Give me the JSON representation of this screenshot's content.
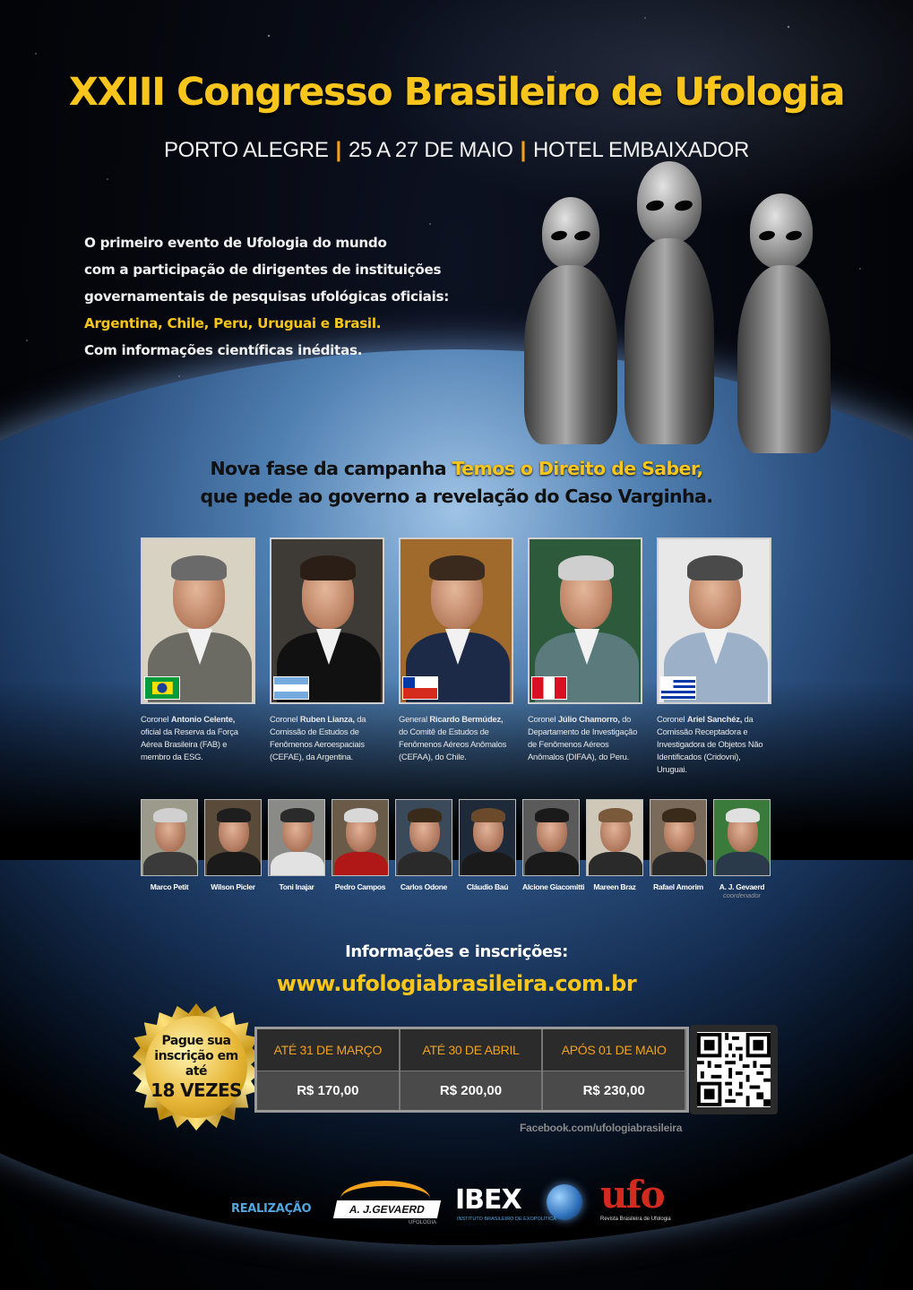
{
  "header": {
    "title": "XXIII Congresso Brasileiro de Ufologia",
    "location": "PORTO ALEGRE",
    "dates": "25 A 27 DE MAIO",
    "venue": "HOTEL EMBAIXADOR",
    "separator": "|"
  },
  "intro": {
    "line1": "O primeiro evento de Ufologia do mundo",
    "line2": "com a participação de dirigentes de instituições",
    "line3": "governamentais de pesquisas ufológicas oficiais:",
    "countries": "Argentina, Chile, Peru, Uruguai e Brasil.",
    "line5": "Com informações científicas inéditas."
  },
  "campaign": {
    "prefix": "Nova fase da campanha ",
    "name": "Temos o Direito de Saber,",
    "line2": "que pede ao governo a revelação do Caso Varginha."
  },
  "main_speakers": [
    {
      "rank": "Coronel ",
      "name": "Antonio Celente,",
      "desc": " oficial da Reserva da Força Aérea Brasileira (FAB) e membro da ESG.",
      "flag": "brazil",
      "bg": "#d8d2c2",
      "suit": "#6b6a63",
      "hair": "#6a6a6a"
    },
    {
      "rank": "Coronel ",
      "name": "Ruben Lianza,",
      "desc": " da Comissão de Estudos de Fenômenos Aeroespaciais (CEFAE), da Argentina.",
      "flag": "argentina",
      "bg": "#3e3a36",
      "suit": "#111111",
      "hair": "#2a1e16"
    },
    {
      "rank": "General ",
      "name": "Ricardo Bermúdez,",
      "desc": " do Comitê de Estudos de Fenômenos Aéreos Anômalos (CEFAA), do Chile.",
      "flag": "chile",
      "bg": "#a06a2c",
      "suit": "#1c2a48",
      "hair": "#3a2a1e"
    },
    {
      "rank": "Coronel ",
      "name": "Júlio Chamorro,",
      "desc": " do Departamento de Investigação de Fenômenos Aéreos Anômalos (DIFAA), do Peru.",
      "flag": "peru",
      "bg": "#2d5a3a",
      "suit": "#5a7a7c",
      "hair": "#cfcfcf"
    },
    {
      "rank": "Coronel ",
      "name": "Ariel Sanchéz,",
      "desc": " da Comissão Receptadora e Investigadora de Objetos Não Identificados (Cridovni), Uruguai.",
      "flag": "uruguay",
      "bg": "#e8e8e8",
      "suit": "#9cb1c8",
      "hair": "#4a4a4a"
    }
  ],
  "other_speakers": [
    {
      "name": "Marco Petit",
      "role": "",
      "bg": "#9c9a8a",
      "hair": "#d0d0d0",
      "suit": "#3a3a3a"
    },
    {
      "name": "Wilson Picler",
      "role": "",
      "bg": "#5a4a3a",
      "hair": "#1e1e1e",
      "suit": "#1a1a1a"
    },
    {
      "name": "Toni Inajar",
      "role": "",
      "bg": "#8a8a86",
      "hair": "#2a2a2a",
      "suit": "#e2e2e2"
    },
    {
      "name": "Pedro Campos",
      "role": "",
      "bg": "#6a5a48",
      "hair": "#d8d8d8",
      "suit": "#b01818"
    },
    {
      "name": "Carlos Odone",
      "role": "",
      "bg": "#3a4a5a",
      "hair": "#3a2a1a",
      "suit": "#2a2a2a"
    },
    {
      "name": "Cláudio Baú",
      "role": "",
      "bg": "#1e2a3a",
      "hair": "#6a4a2a",
      "suit": "#1a1a1a"
    },
    {
      "name": "Alcione Giacomitti",
      "role": "",
      "bg": "#5a5a5a",
      "hair": "#1a1a1a",
      "suit": "#1a1a1a"
    },
    {
      "name": "Mareen Braz",
      "role": "",
      "bg": "#cfc8b8",
      "hair": "#7a5a3a",
      "suit": "#2a2a2a"
    },
    {
      "name": "Rafael Amorim",
      "role": "",
      "bg": "#7a6a5a",
      "hair": "#3a2a1a",
      "suit": "#2a2a2a"
    },
    {
      "name": "A. J. Gevaerd",
      "role": "coordenador",
      "bg": "#3a7a3a",
      "hair": "#e0e0e0",
      "suit": "#2a3a4a"
    }
  ],
  "info": {
    "label": "Informações e inscrições:",
    "url": "www.ufologiabrasileira.com.br"
  },
  "seal": {
    "line1": "Pague sua",
    "line2": "inscrição em até",
    "line3": "18 VEZES"
  },
  "prices": [
    {
      "period": "ATÉ 31 DE MARÇO",
      "price": "R$ 170,00"
    },
    {
      "period": "ATÉ 30 DE ABRIL",
      "price": "R$ 200,00"
    },
    {
      "period": "APÓS 01 DE MAIO",
      "price": "R$ 230,00"
    }
  ],
  "facebook": "Facebook.com/ufologiabrasileira",
  "footer": {
    "realizacao": "REALIZAÇÃO",
    "gevaerd": "A. J.GEVAERD",
    "gevaerd_sub": "UFOLOGIA",
    "ibex": "IBEX",
    "ibex_sub": "INSTITUTO BRASILEIRO DE EXOPOLÍTICA",
    "ufo": "ufo",
    "ufo_sub": "Revista Brasileira de Ufologia"
  },
  "colors": {
    "accent_yellow": "#f7c51b",
    "accent_orange": "#f3a21c",
    "ufo_red": "#d32a1f",
    "footer_blue": "#4fa6e0"
  }
}
